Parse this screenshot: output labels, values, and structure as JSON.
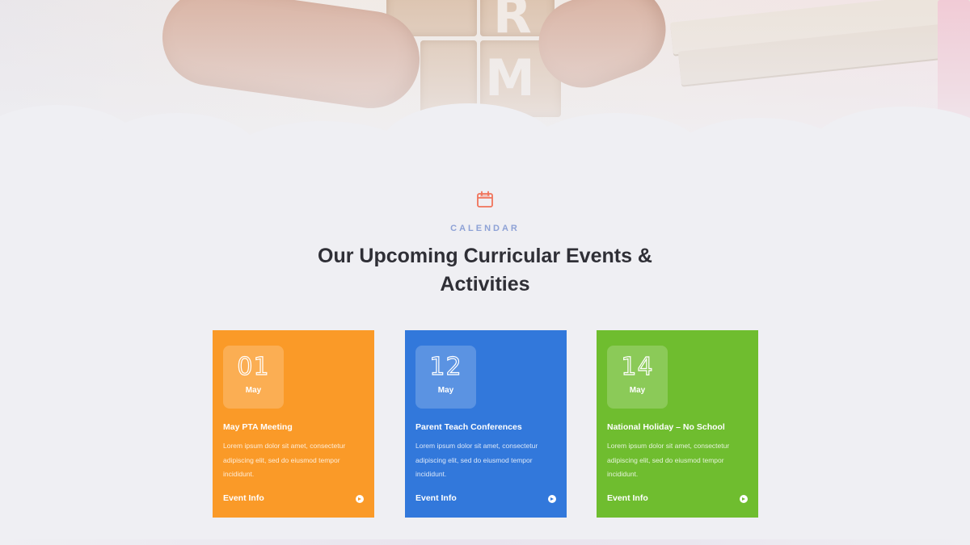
{
  "hero": {
    "image": "hands-with-alphabet-blocks-and-books",
    "block_letters": [
      "R",
      "M"
    ]
  },
  "section": {
    "icon": "calendar-icon",
    "icon_color": "#f0735a",
    "eyebrow": "CALENDAR",
    "heading": "Our Upcoming Curricular Events & Activities"
  },
  "events": [
    {
      "day": "01",
      "month": "May",
      "title": "May PTA Meeting",
      "description": "Lorem ipsum dolor sit amet, consectetur adipiscing elit, sed do eiusmod tempor incididunt.",
      "link": "Event Info",
      "color": "#fa9a28"
    },
    {
      "day": "12",
      "month": "May",
      "title": "Parent Teach Conferences",
      "description": "Lorem ipsum dolor sit amet, consectetur adipiscing elit, sed do eiusmod tempor incididunt.",
      "link": "Event Info",
      "color": "#3278db"
    },
    {
      "day": "14",
      "month": "May",
      "title": "National Holiday – No School",
      "description": "Lorem ipsum dolor sit amet, consectetur adipiscing elit, sed do eiusmod tempor incididunt.",
      "link": "Event Info",
      "color": "#6fbd2f"
    }
  ]
}
